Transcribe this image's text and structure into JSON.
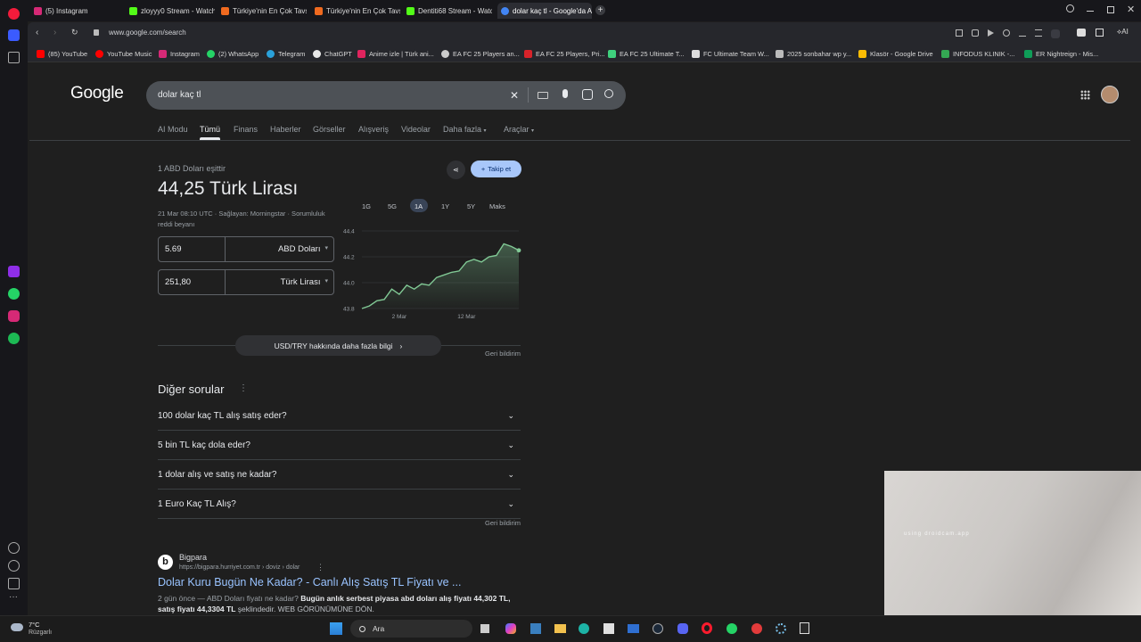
{
  "tabs": [
    {
      "label": "(5) Instagram",
      "color": "#d62976"
    },
    {
      "label": "zloyyy0 Stream - Watch Li",
      "color": "#53fc18"
    },
    {
      "label": "Türkiye'nin En Çok Tavsiye",
      "color": "#f06a1f"
    },
    {
      "label": "Türkiye'nin En Çok Tavsiye",
      "color": "#f06a1f"
    },
    {
      "label": "Dentiti68 Stream - Watch",
      "color": "#53fc18"
    },
    {
      "label": "dolar kaç tl - Google'da A",
      "color": "#4285f4"
    }
  ],
  "address": {
    "url": "www.google.com/search",
    "ai_label": "AI"
  },
  "bookmarks": [
    "(85) YouTube",
    "YouTube Music",
    "Instagram",
    "(2) WhatsApp",
    "Telegram",
    "ChatGPT",
    "Anime izle | Türk ani...",
    "EA FC 25 Players an...",
    "EA FC 25 Players, Pri...",
    "EA FC 25 Ultimate T...",
    "FC Ultimate Team W...",
    "2025 sonbahar wp y...",
    "Klasör - Google Drive",
    "INFODUS KLINIK -...",
    "ER Nightreign - Mis..."
  ],
  "search": {
    "logo": "Google",
    "query": "dolar kaç tl"
  },
  "nav_tabs": [
    "AI Modu",
    "Tümü",
    "Finans",
    "Haberler",
    "Görseller",
    "Alışveriş",
    "Videolar",
    "Daha fazla",
    "Araçlar"
  ],
  "converter": {
    "equals_label": "1 ABD Doları eşittir",
    "result": "44,25 Türk Lirası",
    "meta": "21 Mar 08:10 UTC · Sağlayan: Morningstar · Sorumluluk reddi beyanı",
    "follow_label": "Takip et",
    "from_value": "5.69",
    "from_currency": "ABD Doları",
    "to_value": "251,80",
    "to_currency": "Türk Lirası",
    "ranges": [
      "1G",
      "5G",
      "1A",
      "1Y",
      "5Y",
      "Maks"
    ],
    "selected_range": "1A",
    "more_info": "USD/TRY hakkında daha fazla bilgi",
    "feedback": "Geri bildirim"
  },
  "chart_data": {
    "type": "area",
    "title": "",
    "x_ticks": [
      "2 Mar",
      "12 Mar"
    ],
    "y_ticks": [
      43.8,
      44.0,
      44.2,
      44.4
    ],
    "ylim": [
      43.8,
      44.4
    ],
    "values": [
      43.8,
      43.82,
      43.86,
      43.87,
      43.95,
      43.91,
      43.98,
      43.95,
      43.99,
      43.98,
      44.04,
      44.06,
      44.08,
      44.09,
      44.16,
      44.18,
      44.16,
      44.2,
      44.21,
      44.3,
      44.28,
      44.25
    ],
    "color": "#81c995"
  },
  "other_questions": {
    "title": "Diğer sorular",
    "items": [
      "100 dolar kaç TL alış satış eder?",
      "5 bin TL kaç dola eder?",
      "1 dolar alış ve satış ne kadar?",
      "1 Euro Kaç TL Alış?"
    ],
    "feedback": "Geri bildirim"
  },
  "result": {
    "site": "Bigpara",
    "site_url": "https://bigpara.hurriyet.com.tr › doviz › dolar",
    "title": "Dolar Kuru Bugün Ne Kadar? - Canlı Alış Satış TL Fiyatı ve ...",
    "snippet_prefix": "2 gün önce — ABD Doları fiyatı ne kadar?",
    "snippet_bold": "Bugün anlık serbest piyasa abd doları alış fiyatı 44,302 TL, satış fiyatı 44,3304 TL",
    "snippet_suffix": "şeklindedir. WEB GÖRÜNÜMÜNE DÖN."
  },
  "taskbar": {
    "temp": "7°C",
    "weather": "Rüzgarlı",
    "search_label": "Ara"
  },
  "webcam": {
    "watermark": "using droidcam.app"
  }
}
